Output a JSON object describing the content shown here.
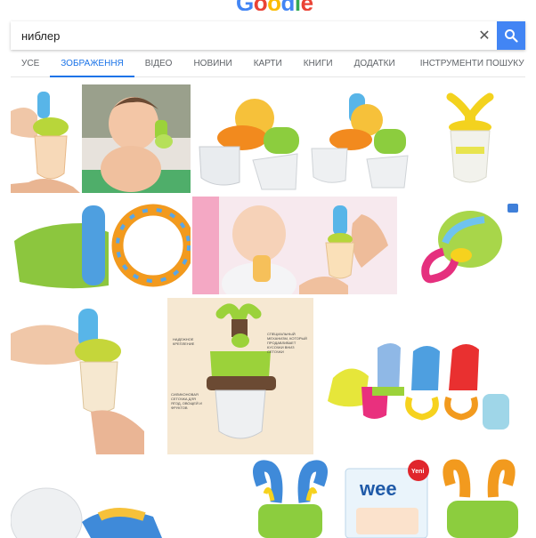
{
  "logo": {
    "letters": [
      "G",
      "o",
      "o",
      "g",
      "l",
      "e"
    ],
    "colors": [
      "#4285f4",
      "#ea4335",
      "#fbbc05",
      "#4285f4",
      "#34a853",
      "#ea4335"
    ]
  },
  "search": {
    "query": "ниблер",
    "clear_icon": "close-icon",
    "submit_icon": "search-icon"
  },
  "tabs": [
    {
      "label": "УСЕ",
      "active": false
    },
    {
      "label": "ЗОБРАЖЕННЯ",
      "active": true
    },
    {
      "label": "ВІДЕО",
      "active": false
    },
    {
      "label": "НОВИНИ",
      "active": false
    },
    {
      "label": "КАРТИ",
      "active": false
    },
    {
      "label": "КНИГИ",
      "active": false
    },
    {
      "label": "ДОДАТКИ",
      "active": false
    },
    {
      "label": "ІНСТРУМЕНТИ ПОШУКУ",
      "active": false
    }
  ],
  "results": {
    "row3": {
      "diagram_labels": {
        "top_left": "НАДЕЖНОЕ КРЕПЛЕНИЕ",
        "top_right": "СПЕЦИАЛЬНЫЙ МЕХАНИЗМ, КОТОРЫЙ ПРОДАВЛИВАЕТ КУСОЧКИ ВНИЗ СЕТОЧКИ",
        "bottom_left": "СИЛИКОНОВАЯ СЕТОЧКА ДЛЯ ЯГОД, ОВОЩЕЙ И ФРУКТОВ"
      }
    },
    "row4": {
      "package_brand": "wee",
      "badge": "Yeni"
    }
  },
  "colors": {
    "accent": "#1a73e8",
    "search_button": "#4285f4"
  }
}
